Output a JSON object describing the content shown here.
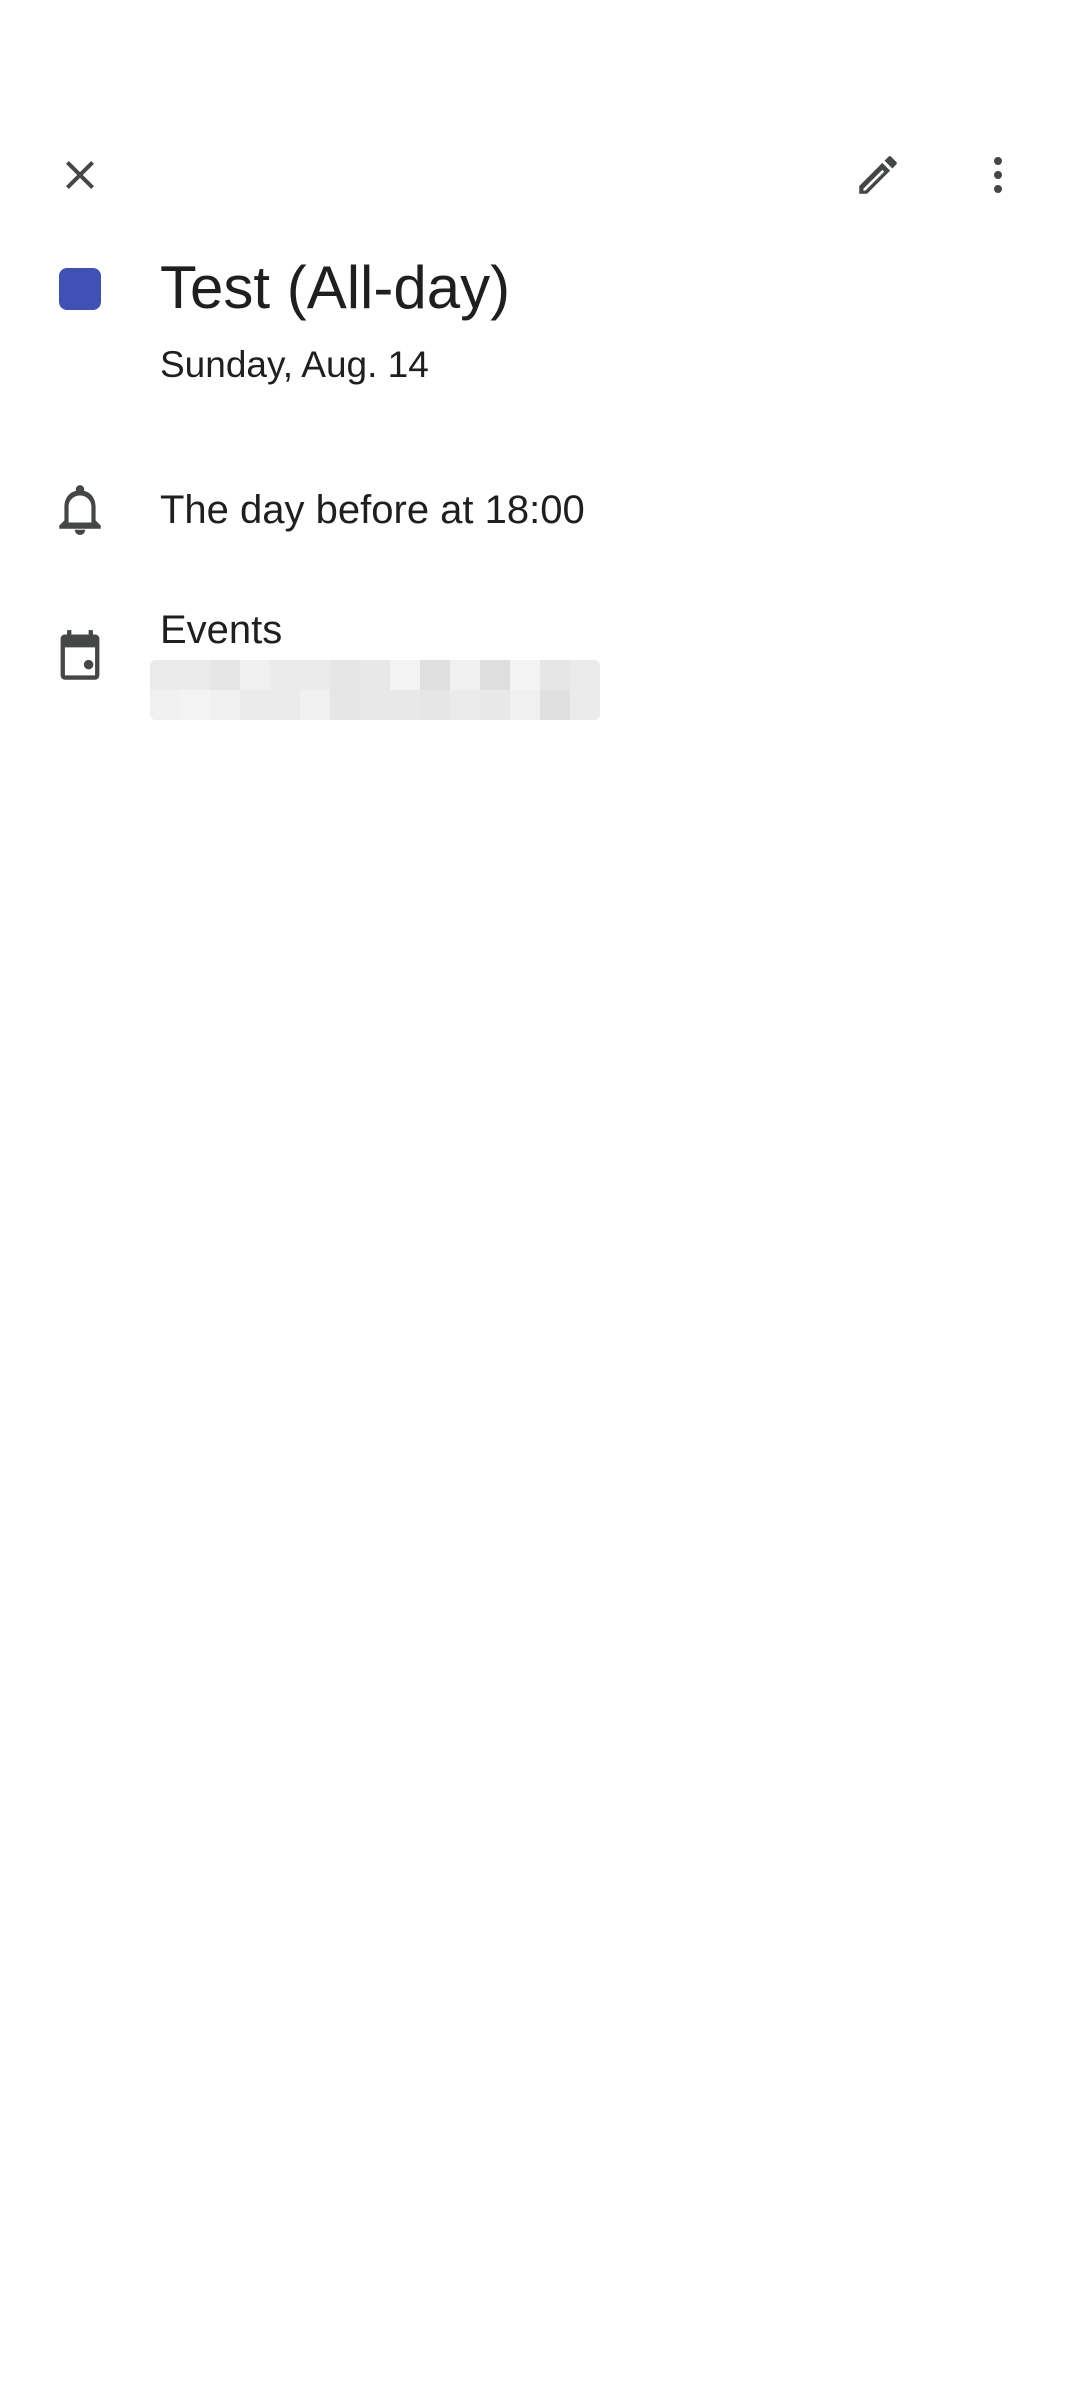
{
  "toolbar": {
    "close_icon": "close-icon",
    "edit_icon": "pencil-icon",
    "more_icon": "more-vert-icon"
  },
  "event": {
    "title": "Test (All-day)",
    "date": "Sunday, Aug. 14",
    "color": "#3f51b5"
  },
  "reminder": {
    "icon": "bell-icon",
    "text": "The day before at 18:00"
  },
  "calendar": {
    "icon": "calendar-icon",
    "name": "Events"
  },
  "colors": {
    "icon": "#444746",
    "text": "#1f1f1f",
    "background": "#ffffff"
  }
}
